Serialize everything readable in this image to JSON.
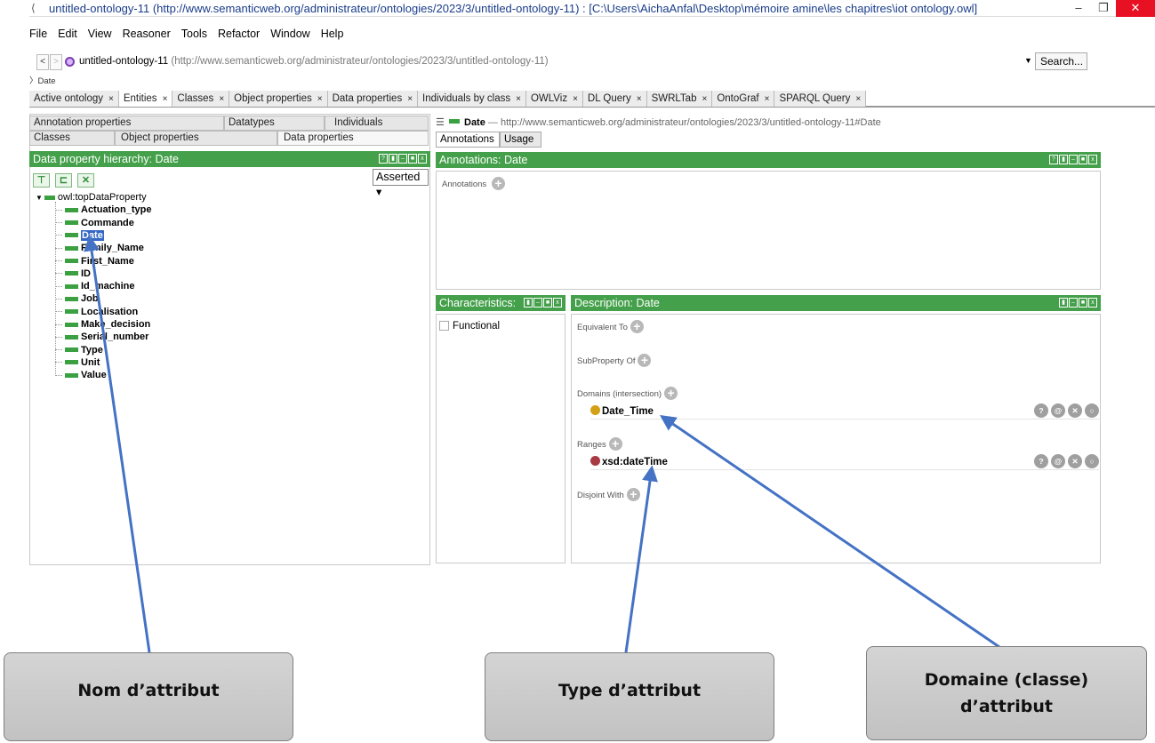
{
  "window": {
    "title": "untitled-ontology-11 (http://www.semanticweb.org/administrateur/ontologies/2023/3/untitled-ontology-11) : [C:\\Users\\AichaAnfal\\Desktop\\mémoire amine\\les chapitres\\iot ontology.owl]",
    "minimize": "–",
    "maximize": "❐",
    "close": "✕"
  },
  "menubar": [
    "File",
    "Edit",
    "View",
    "Reasoner",
    "Tools",
    "Refactor",
    "Window",
    "Help"
  ],
  "nav": {
    "back": "<",
    "forward": ">",
    "ontology_name": "untitled-ontology-11",
    "ontology_iri": "(http://www.semanticweb.org/administrateur/ontologies/2023/3/untitled-ontology-11)",
    "search_label": "Search...",
    "breadcrumb": "〉Date"
  },
  "tabs": [
    {
      "label": "Active ontology",
      "active": false
    },
    {
      "label": "Entities",
      "active": true
    },
    {
      "label": "Classes",
      "active": false
    },
    {
      "label": "Object properties",
      "active": false
    },
    {
      "label": "Data properties",
      "active": false
    },
    {
      "label": "Individuals by class",
      "active": false
    },
    {
      "label": "OWLViz",
      "active": false
    },
    {
      "label": "DL Query",
      "active": false
    },
    {
      "label": "SWRLTab",
      "active": false
    },
    {
      "label": "OntoGraf",
      "active": false
    },
    {
      "label": "SPARQL Query",
      "active": false
    }
  ],
  "tab_close": "×",
  "left_pane": {
    "subtabs_row1": [
      "Annotation properties",
      "Datatypes",
      "Individuals"
    ],
    "subtabs_row2": [
      "Classes",
      "Object properties",
      "Data properties"
    ],
    "hierarchy_header": "Data property hierarchy: Date",
    "asserted": "Asserted",
    "tree_root": "owl:topDataProperty",
    "tree_children": [
      "Actuation_type",
      "Commande",
      "Date",
      "Family_Name",
      "First_Name",
      "ID",
      "Id_machine",
      "Job",
      "Localisation",
      "Make_decision",
      "Serial_number",
      "Type",
      "Unit",
      "Value"
    ],
    "selected": "Date"
  },
  "right_pane": {
    "entity_name": "Date",
    "entity_sep": "—",
    "entity_iri": "http://www.semanticweb.org/administrateur/ontologies/2023/3/untitled-ontology-11#Date",
    "view_tabs": [
      "Annotations",
      "Usage"
    ],
    "annotations_header": "Annotations: Date",
    "annotations_label": "Annotations",
    "characteristics_header": "Characteristics:",
    "functional_label": "Functional",
    "description_header": "Description: Date",
    "equivalent_to": "Equivalent To",
    "subproperty_of": "SubProperty Of",
    "domains": "Domains (intersection)",
    "domain_value": "Date_Time",
    "ranges": "Ranges",
    "range_value": "xsd:dateTime",
    "disjoint_with": "Disjoint With",
    "colors": {
      "domain_dot": "#d4a017",
      "range_dot": "#a83a44",
      "header_green": "#44a04a"
    }
  },
  "callouts": {
    "nom": "Nom d’attribut",
    "type": "Type d’attribut",
    "domaine_line1": "Domaine (classe)",
    "domaine_line2": "d’attribut"
  }
}
